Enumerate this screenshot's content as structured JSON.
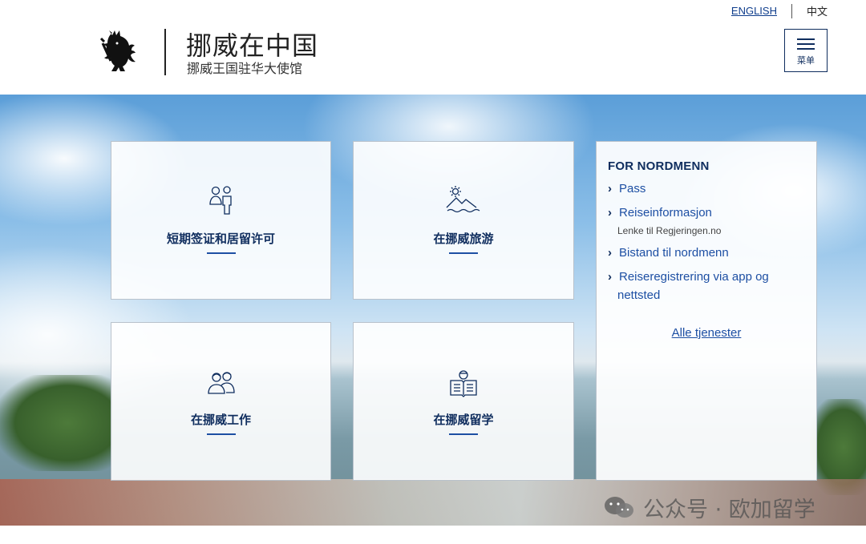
{
  "header": {
    "lang_en": "ENGLISH",
    "lang_zh": "中文",
    "title": "挪威在中国",
    "subtitle": "挪威王国驻华大使馆",
    "menu_label": "菜单"
  },
  "cards": [
    {
      "title": "短期签证和居留许可",
      "icon": "people-icon"
    },
    {
      "title": "在挪威旅游",
      "icon": "mountain-sun-icon"
    },
    {
      "title": "在挪威工作",
      "icon": "workers-icon"
    },
    {
      "title": "在挪威留学",
      "icon": "student-book-icon"
    }
  ],
  "side_panel": {
    "heading": "FOR NORDMENN",
    "links": [
      {
        "label": "Pass"
      },
      {
        "label": "Reiseinformasjon",
        "sub": "Lenke til Regjeringen.no"
      },
      {
        "label": "Bistand til nordmenn"
      },
      {
        "label": "Reiseregistrering via app og",
        "label_line2": "nettsted"
      }
    ],
    "all_services": "Alle tjenester"
  },
  "watermark": "公众号 · 欧加留学",
  "colors": {
    "navy": "#0f2d5e",
    "link_blue": "#1d4fa3"
  }
}
